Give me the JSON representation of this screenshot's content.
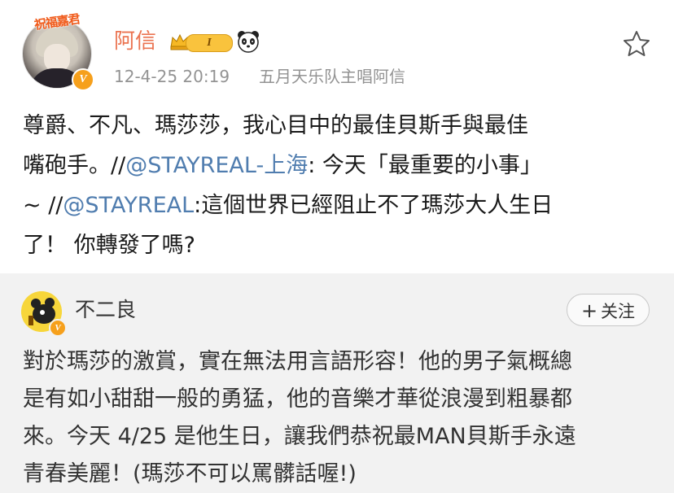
{
  "post": {
    "avatar_caption": "祝福嘉君",
    "username": "阿信",
    "level_badge": "I",
    "time": "12-4-25 20:19",
    "source": "五月天乐队主唱阿信",
    "verified_mark": "V",
    "text_lines": [
      [
        {
          "t": "尊爵、不凡、瑪莎莎，我心目中的最佳貝斯手與最佳"
        }
      ],
      [
        {
          "t": "嘴砲手。//"
        },
        {
          "t": "@STAYREAL-上海",
          "link": true
        },
        {
          "t": ": 今天「最重要的小事」"
        }
      ],
      [
        {
          "t": "~ //"
        },
        {
          "t": "@STAYREAL",
          "link": true
        },
        {
          "t": ":這個世界已經阻止不了瑪莎大人生日"
        }
      ],
      [
        {
          "t": "了！ 你轉發了嗎?"
        }
      ]
    ]
  },
  "repost": {
    "username": "不二良",
    "verified_mark": "V",
    "follow_plus": "+",
    "follow_label": "关注",
    "text_lines": [
      "對於瑪莎的激賞，實在無法用言語形容！他的男子氣概總",
      "是有如小甜甜一般的勇猛，他的音樂才華從浪漫到粗暴都",
      "來。今天 4/25 是他生日，讓我們恭祝最MAN貝斯手永遠",
      "青春美麗！(瑪莎不可以罵髒話喔!)"
    ]
  },
  "colors": {
    "username_orange": "#eb7350",
    "link_blue": "#507daf",
    "meta_gray": "#939393",
    "repost_bg": "#f2f2f2"
  },
  "icons": {
    "crown": "crown-icon",
    "panda": "panda-icon",
    "favorite": "star-outline-icon",
    "verified": "verified-v-icon"
  }
}
